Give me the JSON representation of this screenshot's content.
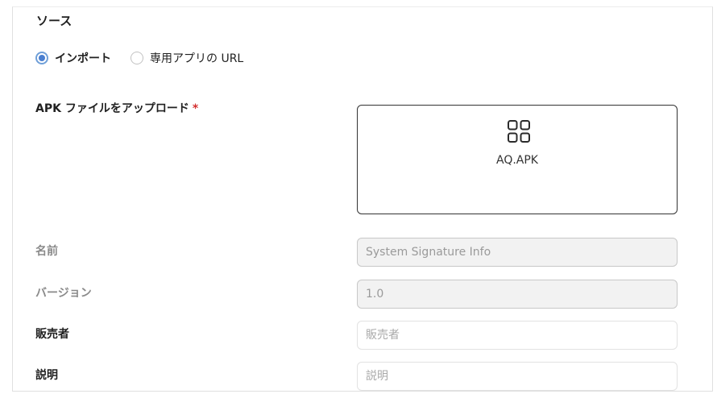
{
  "source": {
    "title": "ソース",
    "options": [
      {
        "label": "インポート",
        "selected": true
      },
      {
        "label": "専用アプリの URL",
        "selected": false
      }
    ]
  },
  "upload": {
    "label": "APK ファイルをアップロード",
    "required_mark": "*",
    "icon": "apps-grid-icon",
    "file_name": "AQ.APK"
  },
  "fields": {
    "name": {
      "label": "名前",
      "value": "System Signature Info",
      "disabled": true
    },
    "version": {
      "label": "バージョン",
      "value": "1.0",
      "disabled": true
    },
    "vendor": {
      "label": "販売者",
      "placeholder": "販売者",
      "value": ""
    },
    "description": {
      "label": "説明",
      "placeholder": "説明",
      "value": ""
    }
  },
  "colors": {
    "radio_accent": "#4a7fd0",
    "required": "#d32f2f",
    "disabled_bg": "#f2f2f2"
  }
}
